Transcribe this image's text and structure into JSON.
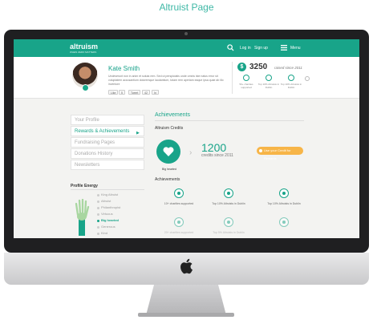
{
  "caption": "Altruist Page",
  "site": {
    "brand": "altruism",
    "tagline": "WHEN ZERO MATTERS",
    "nav": {
      "login": "Log in",
      "signup": "Sign up",
      "menu": "Menu"
    }
  },
  "profile": {
    "name": "Kate Smith",
    "bio": "Undeserunt non in anim et soluta rem. Sed ut perspiciatis unde omnis iste natus error sit voluptatem accusantium doloremque laudantium, totam rem aperiam eaque ipsa quae ab illo inventore",
    "share": {
      "like": "Like",
      "likes": "5",
      "tweet": "Tweet",
      "tweets": "42",
      "linked": "In"
    },
    "credits": "3250",
    "credits_since": "raised since 2011",
    "stats": [
      {
        "label": "50+ charities supported"
      },
      {
        "label": "Top 10% Altruists in Dublin"
      },
      {
        "label": "Top 10% Altruists in Dublin"
      }
    ]
  },
  "sidebar": {
    "items": [
      {
        "label": "Your Profile"
      },
      {
        "label": "Rewards & Achievements"
      },
      {
        "label": "Fundraising Pages"
      },
      {
        "label": "Donations History"
      },
      {
        "label": "Newsletters"
      }
    ],
    "energy_title": "Profile Energy",
    "levels": [
      "King Altruist",
      "Altruist",
      "Philanthropist",
      "Virtuous",
      "Big hearted",
      "Generous",
      "Kind"
    ],
    "current_level": "Big hearted"
  },
  "main": {
    "title": "Achievements",
    "credits_label": "Altruism Credits",
    "badge_label": "Big hearted",
    "credits_value": "1200",
    "credits_since": "credits since 2011",
    "cta": "Use your Credit for Rewards",
    "achievements_label": "Achievements",
    "achievements": [
      {
        "label": "10+ charities supported"
      },
      {
        "label": "Top 10% Altruists in Dublin"
      },
      {
        "label": "Top 10% Altruists in Dublin"
      }
    ],
    "achievements_row2": [
      {
        "label": "20+ charities supported"
      },
      {
        "label": "Top 5% Altruists in Dublin"
      }
    ]
  },
  "colors": {
    "brand": "#18a489",
    "cta": "#f7b548"
  }
}
